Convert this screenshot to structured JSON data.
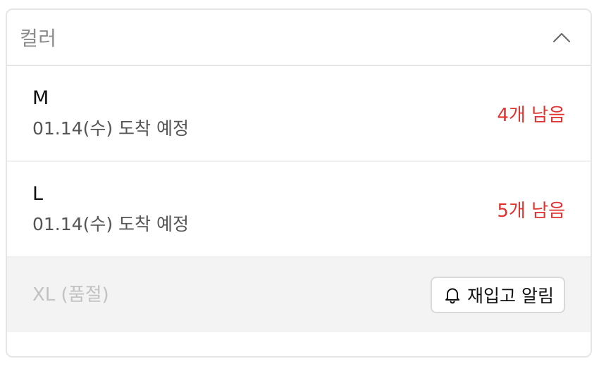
{
  "dropdown": {
    "label": "컬러",
    "icon": "chevron-up-icon",
    "expanded": true,
    "options": [
      {
        "size": "M",
        "eta": "01.14(수) 도착 예정",
        "stock": "4개 남음",
        "sold_out": false
      },
      {
        "size": "L",
        "eta": "01.14(수) 도착 예정",
        "stock": "5개 남음",
        "sold_out": false
      },
      {
        "size": "XL (품절)",
        "sold_out": true,
        "restock_label": "재입고 알림",
        "restock_icon": "bell-icon"
      }
    ]
  },
  "colors": {
    "stock": "#e0332f",
    "soldout_bg": "#f3f3f3",
    "muted": "#c2c2c2"
  }
}
